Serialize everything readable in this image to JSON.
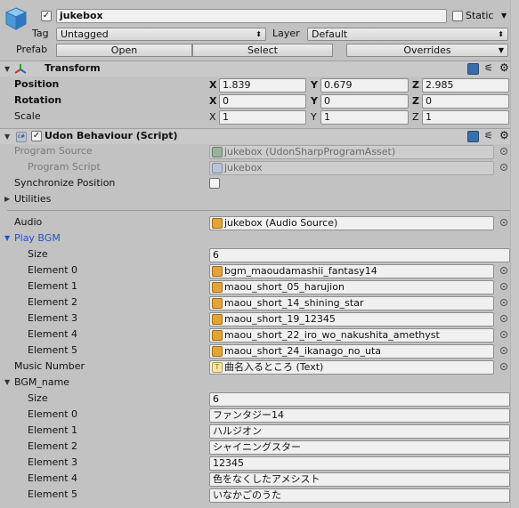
{
  "object": {
    "name": "jukebox",
    "active": true,
    "static_label": "Static",
    "static_checked": false,
    "tag_label": "Tag",
    "tag_value": "Untagged",
    "layer_label": "Layer",
    "layer_value": "Default",
    "prefab_label": "Prefab",
    "open_label": "Open",
    "select_label": "Select",
    "overrides_label": "Overrides"
  },
  "transform": {
    "title": "Transform",
    "position_label": "Position",
    "rotation_label": "Rotation",
    "scale_label": "Scale",
    "axis_x": "X",
    "axis_y": "Y",
    "axis_z": "Z",
    "position": {
      "x": "1.839",
      "y": "0.679",
      "z": "2.985"
    },
    "rotation": {
      "x": "0",
      "y": "0",
      "z": "0"
    },
    "scale": {
      "x": "1",
      "y": "1",
      "z": "1"
    }
  },
  "udon": {
    "title": "Udon Behaviour (Script)",
    "enabled": true,
    "program_source_label": "Program Source",
    "program_source_value": "jukebox (UdonSharpProgramAsset)",
    "program_script_label": "Program Script",
    "program_script_value": "jukebox",
    "sync_position_label": "Synchronize Position",
    "sync_position_checked": false,
    "utilities_label": "Utilities",
    "audio_label": "Audio",
    "audio_value": "jukebox (Audio Source)",
    "play_bgm_label": "Play BGM",
    "size_label": "Size",
    "play_bgm_size": "6",
    "play_bgm_elements": [
      {
        "label": "Element 0",
        "value": "bgm_maoudamashii_fantasy14"
      },
      {
        "label": "Element 1",
        "value": "maou_short_05_harujion"
      },
      {
        "label": "Element 2",
        "value": "maou_short_14_shining_star"
      },
      {
        "label": "Element 3",
        "value": "maou_short_19_12345"
      },
      {
        "label": "Element 4",
        "value": "maou_short_22_iro_wo_nakushita_amethyst"
      },
      {
        "label": "Element 5",
        "value": "maou_short_24_ikanago_no_uta"
      }
    ],
    "music_number_label": "Music Number",
    "music_number_value": "曲名入るところ (Text)",
    "bgm_name_label": "BGM_name",
    "bgm_name_size": "6",
    "bgm_name_elements": [
      {
        "label": "Element 0",
        "value": "ファンタジー14"
      },
      {
        "label": "Element 1",
        "value": "ハルジオン"
      },
      {
        "label": "Element 2",
        "value": "シャイニングスター"
      },
      {
        "label": "Element 3",
        "value": "12345"
      },
      {
        "label": "Element 4",
        "value": "色をなくしたアメシスト"
      },
      {
        "label": "Element 5",
        "value": "いなかごのうた"
      }
    ]
  },
  "colors": {
    "accent_blue": "#1a56c9",
    "panel": "#c2c2c2"
  }
}
